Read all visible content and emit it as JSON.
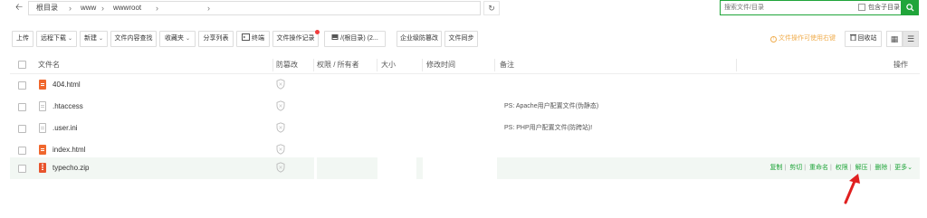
{
  "pathbar": {
    "back_icon": "arrow-left-icon",
    "crumbs": [
      "根目录",
      "www",
      "wwwroot"
    ],
    "refresh_icon": "refresh-icon"
  },
  "search": {
    "placeholder": "搜索文件/目录",
    "subdir_label": "包含子目录",
    "search_icon": "search-icon"
  },
  "toolbar": {
    "upload": "上传",
    "remote_download": "远程下载",
    "new": "新建",
    "content_search": "文件内容查找",
    "favorites": "收藏夹",
    "share_list": "分享列表",
    "terminal": "终端",
    "file_log": "文件操作记录",
    "disk": "/(根目录) (2...",
    "tamper": "企业级防篡改",
    "sync": "文件同步",
    "tip": "文件操作可使用右键",
    "recycle": "回收站"
  },
  "table": {
    "headers": {
      "name": "文件名",
      "tamper": "防篡改",
      "perm": "权限 / 所有者",
      "size": "大小",
      "mtime": "修改时间",
      "remark": "备注",
      "ops": "操作"
    },
    "rows": [
      {
        "name": "404.html",
        "type": "html",
        "remark": ""
      },
      {
        "name": ".htaccess",
        "type": "doc",
        "remark": "PS: Apache用户配置文件(伪静态)"
      },
      {
        "name": ".user.ini",
        "type": "doc",
        "remark": "PS: PHP用户配置文件(防跨站)!"
      },
      {
        "name": "index.html",
        "type": "html",
        "remark": ""
      },
      {
        "name": "typecho.zip",
        "type": "zip",
        "remark": ""
      }
    ],
    "row_ops": [
      "复制",
      "剪切",
      "重命名",
      "权限",
      "解压",
      "删除",
      "更多"
    ]
  },
  "colors": {
    "accent": "#20a53a",
    "tip": "#f0ad4e",
    "arrow": "#e02020"
  }
}
